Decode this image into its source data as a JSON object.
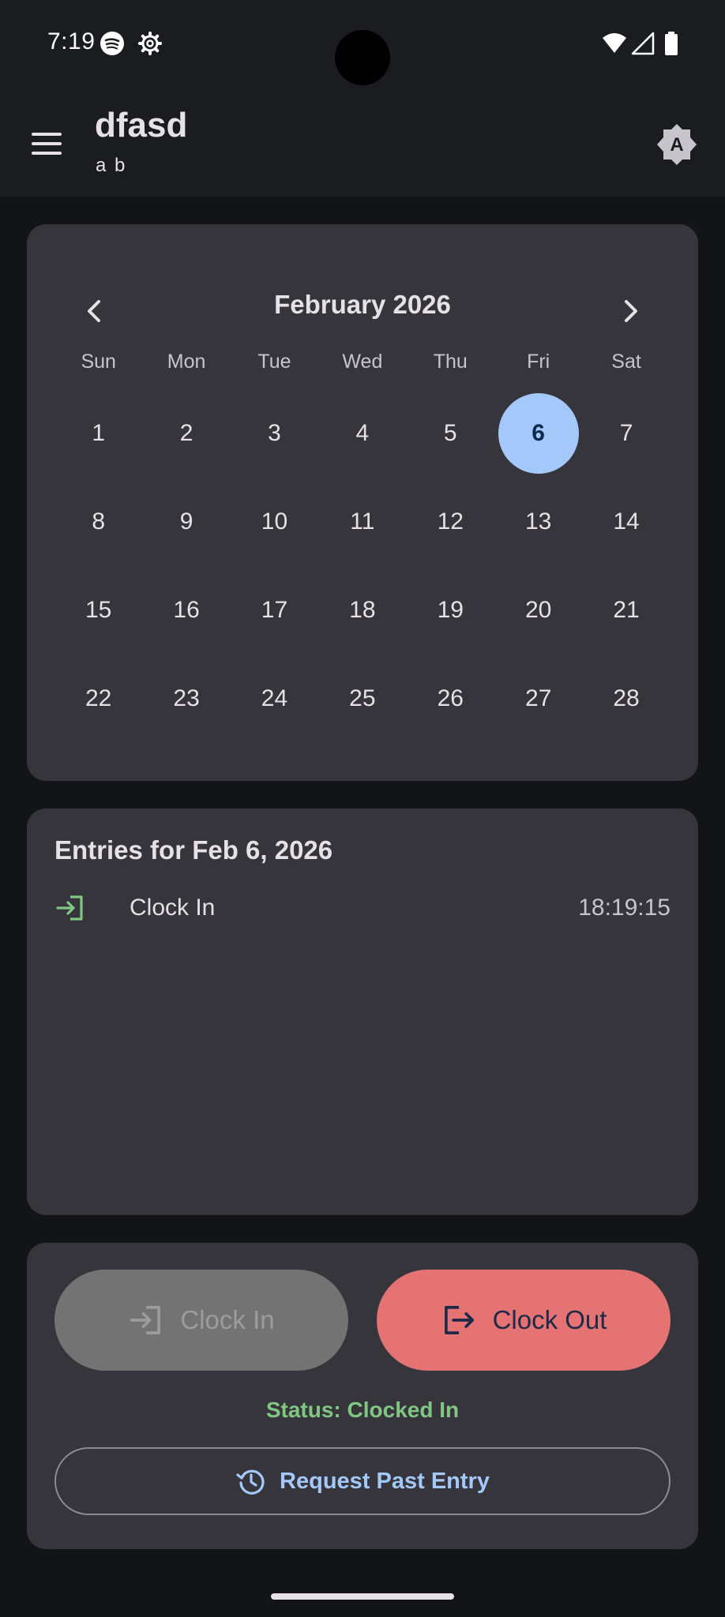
{
  "status_bar": {
    "time": "7:19",
    "icons": [
      "spotify-icon",
      "settings-icon",
      "wifi-icon",
      "signal-icon",
      "battery-icon"
    ]
  },
  "app_bar": {
    "title": "dfasd",
    "subtitle": "a b",
    "menu_icon": "menu-icon",
    "theme_icon": "auto-theme-icon"
  },
  "calendar": {
    "month_label": "February 2026",
    "weekdays": [
      "Sun",
      "Mon",
      "Tue",
      "Wed",
      "Thu",
      "Fri",
      "Sat"
    ],
    "weeks": [
      [
        "1",
        "2",
        "3",
        "4",
        "5",
        "6",
        "7"
      ],
      [
        "8",
        "9",
        "10",
        "11",
        "12",
        "13",
        "14"
      ],
      [
        "15",
        "16",
        "17",
        "18",
        "19",
        "20",
        "21"
      ],
      [
        "22",
        "23",
        "24",
        "25",
        "26",
        "27",
        "28"
      ]
    ],
    "selected_day": "6"
  },
  "entries": {
    "title": "Entries for Feb 6, 2026",
    "items": [
      {
        "label": "Clock In",
        "time": "18:19:15",
        "icon": "login-icon"
      }
    ]
  },
  "actions": {
    "clock_in_label": "Clock In",
    "clock_out_label": "Clock Out",
    "status_text": "Status: Clocked In",
    "request_label": "Request Past Entry"
  },
  "colors": {
    "accent": "#a5c8fb",
    "clock_out": "#e57373",
    "status_green": "#81c784",
    "card_bg": "#35353b"
  }
}
